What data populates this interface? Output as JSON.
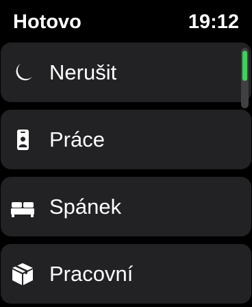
{
  "header": {
    "done_label": "Hotovo",
    "time": "19:12"
  },
  "focus_modes": [
    {
      "label": "Nerušit",
      "icon": "moon-icon"
    },
    {
      "label": "Práce",
      "icon": "id-badge-icon"
    },
    {
      "label": "Spánek",
      "icon": "bed-icon"
    },
    {
      "label": "Pracovní",
      "icon": "box-icon"
    }
  ],
  "colors": {
    "background": "#000000",
    "row_background": "#222224",
    "text": "#ffffff",
    "scroll_accent": "#3cd35b"
  }
}
